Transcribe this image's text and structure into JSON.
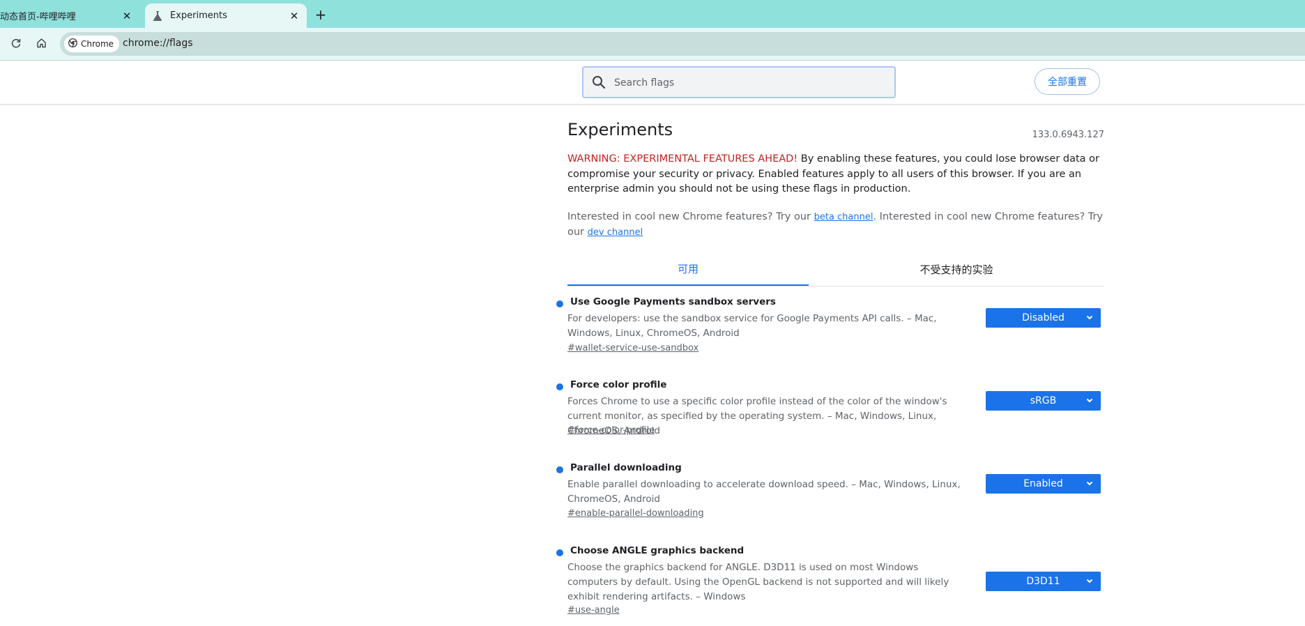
{
  "browser": {
    "tabs": [
      {
        "title": "动态首页-哔哩哔哩",
        "close": "✕"
      },
      {
        "title": "Experiments",
        "close": "✕"
      }
    ],
    "new_tab": "+",
    "omnibox": {
      "chip_label": "Chrome",
      "url": "chrome://flags"
    }
  },
  "header": {
    "search_placeholder": "Search flags",
    "reset_all_label": "全部重置"
  },
  "main": {
    "title": "Experiments",
    "version": "133.0.6943.127",
    "warning_prefix": "WARNING: EXPERIMENTAL FEATURES AHEAD!",
    "warning_text": " By enabling these features, you could lose browser data or compromise your security or privacy. Enabled features apply to all users of this browser. If you are an enterprise admin you should not be using these flags in production.",
    "promo_text_1": "Interested in cool new Chrome features? Try our ",
    "promo_link_1": "beta channel",
    "promo_text_2": ". Interested in cool new Chrome features? Try our ",
    "promo_link_2": "dev channel",
    "tabs": [
      "可用",
      "不受支持的实验"
    ]
  },
  "flags": [
    {
      "name": "Use Google Payments sandbox servers",
      "description": "For developers: use the sandbox service for Google Payments API calls. – Mac, Windows, Linux, ChromeOS, Android",
      "permalink": "#wallet-service-use-sandbox",
      "value": "Disabled"
    },
    {
      "name": "Force color profile",
      "description": "Forces Chrome to use a specific color profile instead of the color of the window's current monitor, as specified by the operating system. – Mac, Windows, Linux, ChromeOS, Android",
      "permalink": "#force-color-profile",
      "value": "sRGB"
    },
    {
      "name": "Parallel downloading",
      "description": "Enable parallel downloading to accelerate download speed. – Mac, Windows, Linux, ChromeOS, Android",
      "permalink": "#enable-parallel-downloading",
      "value": "Enabled"
    },
    {
      "name": "Choose ANGLE graphics backend",
      "description": "Choose the graphics backend for ANGLE. D3D11 is used on most Windows computers by default. Using the OpenGL backend is not supported and will likely exhibit rendering artifacts. – Windows",
      "permalink": "#use-angle",
      "value": "D3D11"
    }
  ],
  "colors": {
    "accent": "#1a73e8",
    "warning": "#c5221f",
    "tabstrip": "#8fe1dc",
    "toolbar": "#e6f7f6"
  }
}
